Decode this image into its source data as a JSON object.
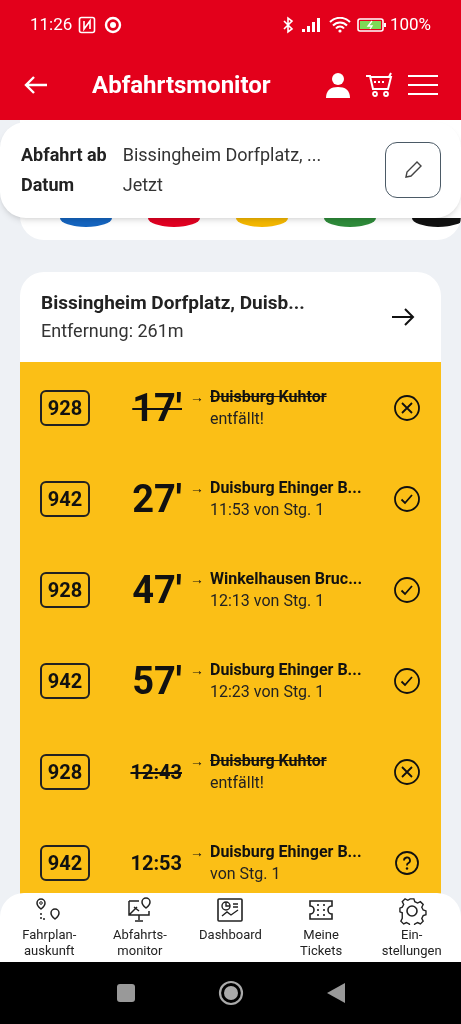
{
  "status_bar": {
    "time": "11:26",
    "battery": "100%"
  },
  "header": {
    "title": "Abfahrtsmonitor"
  },
  "query": {
    "from_label": "Abfahrt ab",
    "from_value": "Bissingheim Dorfplatz, ...",
    "date_label": "Datum",
    "date_value": "Jetzt"
  },
  "line_filters": [
    {
      "color": "#1565c0"
    },
    {
      "color": "#e30022"
    },
    {
      "color": "#f5b800"
    },
    {
      "color": "#2e8b3a"
    },
    {
      "color": "#111111"
    }
  ],
  "station": {
    "name": "Bissingheim Dorfplatz, Duisb...",
    "distance": "Entfernung: 261m"
  },
  "departures": [
    {
      "line": "928",
      "time": "17'",
      "kind": "minutes",
      "arrow": "→",
      "destination": "Duisburg Kuhtor",
      "info": "entfällt!",
      "cancelled": true
    },
    {
      "line": "942",
      "time": "27'",
      "kind": "minutes",
      "arrow": "→",
      "destination": "Duisburg Ehinger B...",
      "info": "11:53 von Stg. 1",
      "cancelled": false,
      "confirmed": true
    },
    {
      "line": "928",
      "time": "47'",
      "kind": "minutes",
      "arrow": "→",
      "destination": "Winkelhausen Bruc...",
      "info": "12:13 von Stg. 1",
      "cancelled": false,
      "confirmed": true
    },
    {
      "line": "942",
      "time": "57'",
      "kind": "minutes",
      "arrow": "→",
      "destination": "Duisburg Ehinger B...",
      "info": "12:23 von Stg. 1",
      "cancelled": false,
      "confirmed": true
    },
    {
      "line": "928",
      "time": "12:43",
      "kind": "clock",
      "arrow": "→",
      "destination": "Duisburg Kuhtor",
      "info": "entfällt!",
      "cancelled": true
    },
    {
      "line": "942",
      "time": "12:53",
      "kind": "clock",
      "arrow": "→",
      "destination": "Duisburg Ehinger B...",
      "info": "von Stg. 1",
      "cancelled": false,
      "confirmed": false
    }
  ],
  "bottom_nav": [
    {
      "label": "Fahrplan-\nauskunft"
    },
    {
      "label": "Abfahrts-\nmonitor"
    },
    {
      "label": "Dashboard"
    },
    {
      "label": "Meine\nTickets"
    },
    {
      "label": "Ein-\nstellungen"
    }
  ]
}
